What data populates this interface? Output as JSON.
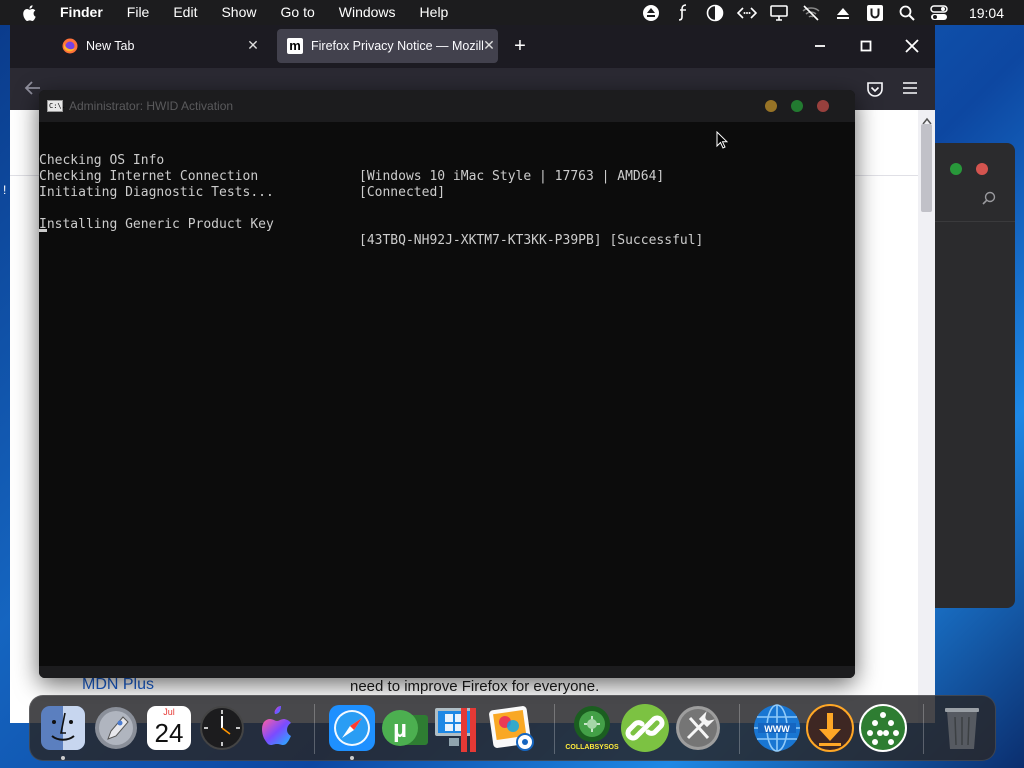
{
  "menubar": {
    "app_name": "Finder",
    "menus": [
      "File",
      "Edit",
      "Show",
      "Go to",
      "Windows",
      "Help"
    ],
    "clock": "19:04",
    "status_icons": [
      "eject-icon",
      "script-icon",
      "contrast-icon",
      "code-icon",
      "display-icon",
      "mute-network-icon",
      "upload-icon",
      "u-badge-icon",
      "search-icon",
      "control-center-icon"
    ]
  },
  "firefox": {
    "tabs": [
      {
        "title": "New Tab",
        "favicon": "firefox-icon"
      },
      {
        "title": "Firefox Privacy Notice — Mozilla",
        "favicon": "mdn-icon",
        "favicon_letter": "m"
      }
    ],
    "new_tab_label": "+",
    "page": {
      "link": "MDN Plus",
      "text": "need to improve Firefox for everyone."
    }
  },
  "console": {
    "title": "Administrator:  HWID Activation",
    "icon_text": "C:\\.",
    "lines": [
      {
        "left": "Checking OS Info",
        "right": "[Windows 10 iMac Style | 17763 | AMD64]"
      },
      {
        "left": "Checking Internet Connection",
        "right": "[Connected]"
      },
      {
        "left": "Initiating Diagnostic Tests...",
        "right": ""
      },
      {
        "left": "",
        "right": ""
      },
      {
        "left": "Installing Generic Product Key",
        "right": "[43TBQ-NH92J-XKTM7-KT3KK-P39PB] [Successful]"
      }
    ]
  },
  "dock": {
    "calendar_month": "Jul",
    "calendar_day": "24",
    "collab_label": "COLLABSYSOS",
    "apps": [
      "finder-icon",
      "launchpad-icon",
      "calendar-icon",
      "clock-icon",
      "macos-icon",
      "safari-icon",
      "utorrent-icon",
      "parallels-icon",
      "photos-icon",
      "collabsysos-icon",
      "link-icon",
      "system-tools-icon",
      "globe-icon",
      "downloader-icon",
      "network-icon",
      "trash-icon"
    ]
  },
  "colors": {
    "menubar_bg": "#1c1c1e",
    "console_bg": "#0c0c0c",
    "console_text": "#cccccc",
    "light_red": "#ff5f57",
    "light_yellow": "#febc2e",
    "light_green": "#28c840",
    "link": "#1a5fd1"
  }
}
